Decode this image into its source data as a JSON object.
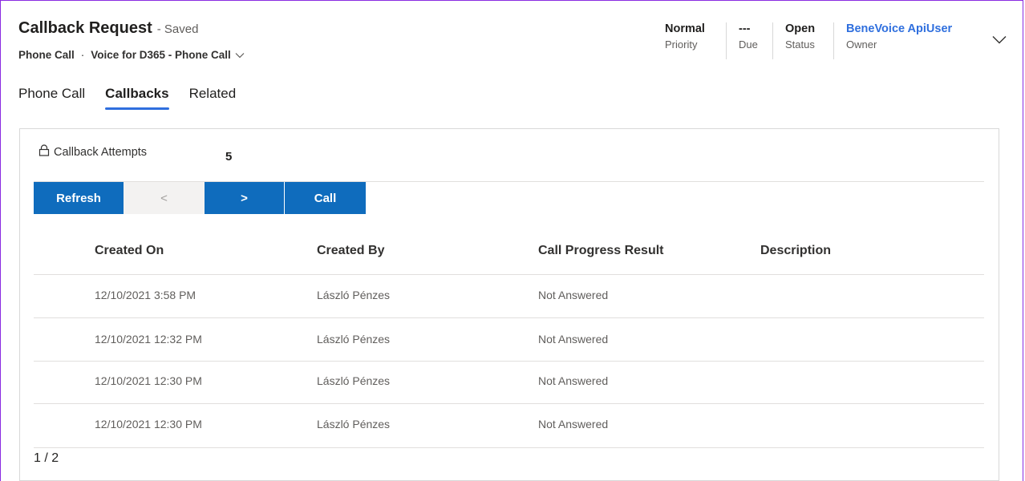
{
  "header": {
    "title": "Callback Request",
    "saved_state": "- Saved",
    "entity": "Phone Call",
    "separator": "·",
    "form_selector": "Voice for D365 - Phone Call"
  },
  "header_fields": {
    "priority": {
      "value": "Normal",
      "label": "Priority"
    },
    "due": {
      "value": "---",
      "label": "Due"
    },
    "status": {
      "value": "Open",
      "label": "Status"
    },
    "owner": {
      "value": "BeneVoice ApiUser",
      "label": "Owner"
    }
  },
  "tabs": [
    {
      "label": "Phone Call",
      "active": false
    },
    {
      "label": "Callbacks",
      "active": true
    },
    {
      "label": "Related",
      "active": false
    }
  ],
  "callbacks": {
    "attempts_label": "Callback Attempts",
    "attempts_value": "5",
    "buttons": {
      "refresh": "Refresh",
      "prev": "<",
      "next": ">",
      "call": "Call"
    },
    "columns": [
      "Created On",
      "Created By",
      "Call Progress Result",
      "Description"
    ],
    "rows": [
      {
        "created_on": "12/10/2021 3:58 PM",
        "created_by": "László Pénzes",
        "result": "Not Answered",
        "description": ""
      },
      {
        "created_on": "12/10/2021 12:32 PM",
        "created_by": "László Pénzes",
        "result": "Not Answered",
        "description": ""
      },
      {
        "created_on": "12/10/2021 12:30 PM",
        "created_by": "László Pénzes",
        "result": "Not Answered",
        "description": ""
      },
      {
        "created_on": "12/10/2021 12:30 PM",
        "created_by": "László Pénzes",
        "result": "Not Answered",
        "description": ""
      }
    ],
    "pager": "1 / 2"
  },
  "colors": {
    "accent": "#0f6cbd",
    "link": "#2f6fde",
    "frame": "#8a2be2"
  }
}
